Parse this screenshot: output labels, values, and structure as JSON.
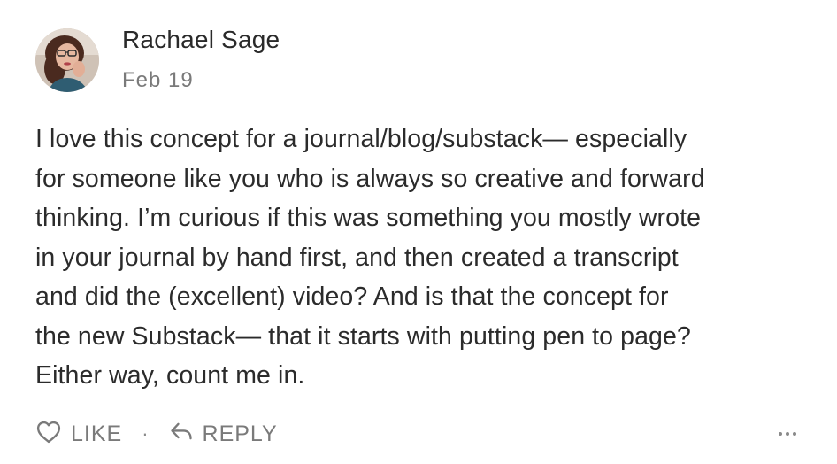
{
  "comment": {
    "author": "Rachael Sage",
    "date": "Feb  19",
    "body": "I love this concept for a journal/blog/substack— especially\nfor someone like you who is always so creative and forward\nthinking. I’m curious if this was something you mostly wrote\nin your journal by hand first, and then created a transcript\nand did the (excellent) video? And is that the concept for\nthe new Substack— that it starts with putting pen to page?\nEither way, count me in."
  },
  "actions": {
    "like_label": "LIKE",
    "separator": "·",
    "reply_label": "REPLY"
  },
  "icons": {
    "like": "heart-outline-icon",
    "reply": "reply-arrow-icon",
    "more": "more-horizontal-icon"
  },
  "colors": {
    "text": "#2b2b2b",
    "muted": "#7a7a7a"
  }
}
